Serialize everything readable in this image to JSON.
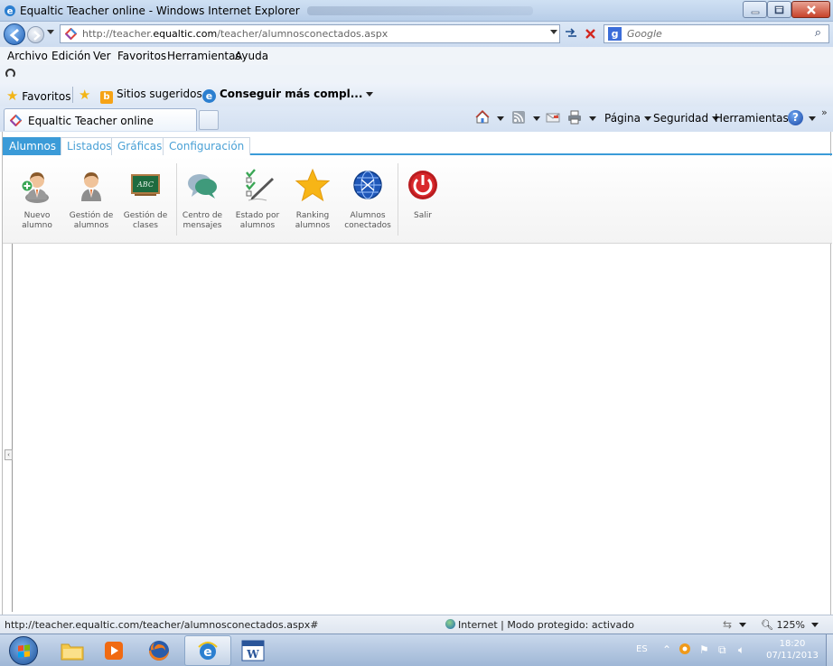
{
  "window": {
    "title": "Equaltic Teacher online - Windows Internet Explorer"
  },
  "address": {
    "url_prefix": "http://teacher.",
    "url_domain": "equaltic.com",
    "url_suffix": "/teacher/alumnosconectados.aspx"
  },
  "search": {
    "placeholder": "Google",
    "engine_logo": "g"
  },
  "menu": {
    "items": [
      "Archivo",
      "Edición",
      "Ver",
      "Favoritos",
      "Herramientas",
      "Ayuda"
    ]
  },
  "favorites_bar": {
    "favorites_label": "Favoritos",
    "suggested_label": "Sitios sugeridos",
    "more_label": "Conseguir más compl...",
    "bing_logo": "b",
    "ie_logo": "e"
  },
  "tab": {
    "label": "Equaltic Teacher online"
  },
  "command_bar": {
    "page_label": "Página",
    "security_label": "Seguridad",
    "tools_label": "Herramientas",
    "help_label": "?",
    "chevrons": "»"
  },
  "app": {
    "tabs": [
      "Alumnos",
      "Listados",
      "Gráficas",
      "Configuración"
    ],
    "active_tab": "Alumnos",
    "ribbon": [
      {
        "label": "Nuevo alumno",
        "icon": "new-student-icon"
      },
      {
        "label": "Gestión de alumnos",
        "icon": "manage-students-icon"
      },
      {
        "label": "Gestión de clases",
        "icon": "chalkboard-icon"
      },
      {
        "label": "Centro de mensajes",
        "icon": "message-bubbles-icon"
      },
      {
        "label": "Estado por alumnos",
        "icon": "checklist-icon"
      },
      {
        "label": "Ranking alumnos",
        "icon": "star-icon"
      },
      {
        "label": "Alumnos conectados",
        "icon": "globe-connected-icon"
      },
      {
        "label": "Salir",
        "icon": "power-icon"
      }
    ],
    "chalkboard_text": "ABC"
  },
  "status": {
    "url": "http://teacher.equaltic.com/teacher/alumnosconectados.aspx#",
    "zone": "Internet | Modo protegido: activado",
    "zoom": "125%"
  },
  "taskbar": {
    "language": "ES",
    "time": "18:20",
    "date": "07/11/2013",
    "word_icon_text": "W"
  },
  "colors": {
    "accent_tab": "#3b9bd8",
    "power_red": "#d9282b",
    "star_gold": "#f7b516"
  }
}
